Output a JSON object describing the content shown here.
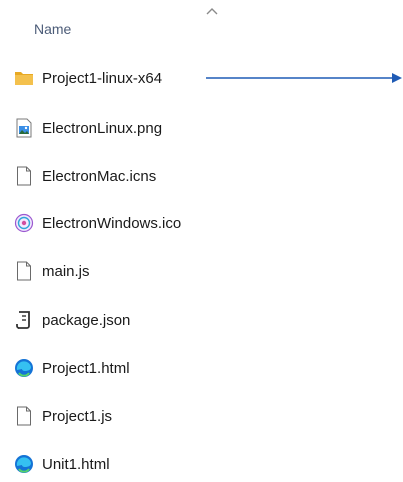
{
  "header": {
    "column_name": "Name",
    "sort_icon": "chevron-up-icon"
  },
  "files": [
    {
      "name": "Project1-linux-x64",
      "icon": "folder-icon"
    },
    {
      "name": "ElectronLinux.png",
      "icon": "image-file-icon"
    },
    {
      "name": "ElectronMac.icns",
      "icon": "blank-file-icon"
    },
    {
      "name": "ElectronWindows.ico",
      "icon": "ico-file-icon"
    },
    {
      "name": "main.js",
      "icon": "blank-file-icon"
    },
    {
      "name": "package.json",
      "icon": "json-file-icon"
    },
    {
      "name": "Project1.html",
      "icon": "edge-browser-icon"
    },
    {
      "name": "Project1.js",
      "icon": "blank-file-icon"
    },
    {
      "name": "Unit1.html",
      "icon": "edge-browser-icon"
    }
  ],
  "colors": {
    "accent_arrow": "#1f5bb5",
    "folder": "#f4c14d",
    "header_text": "#4c5c78"
  }
}
